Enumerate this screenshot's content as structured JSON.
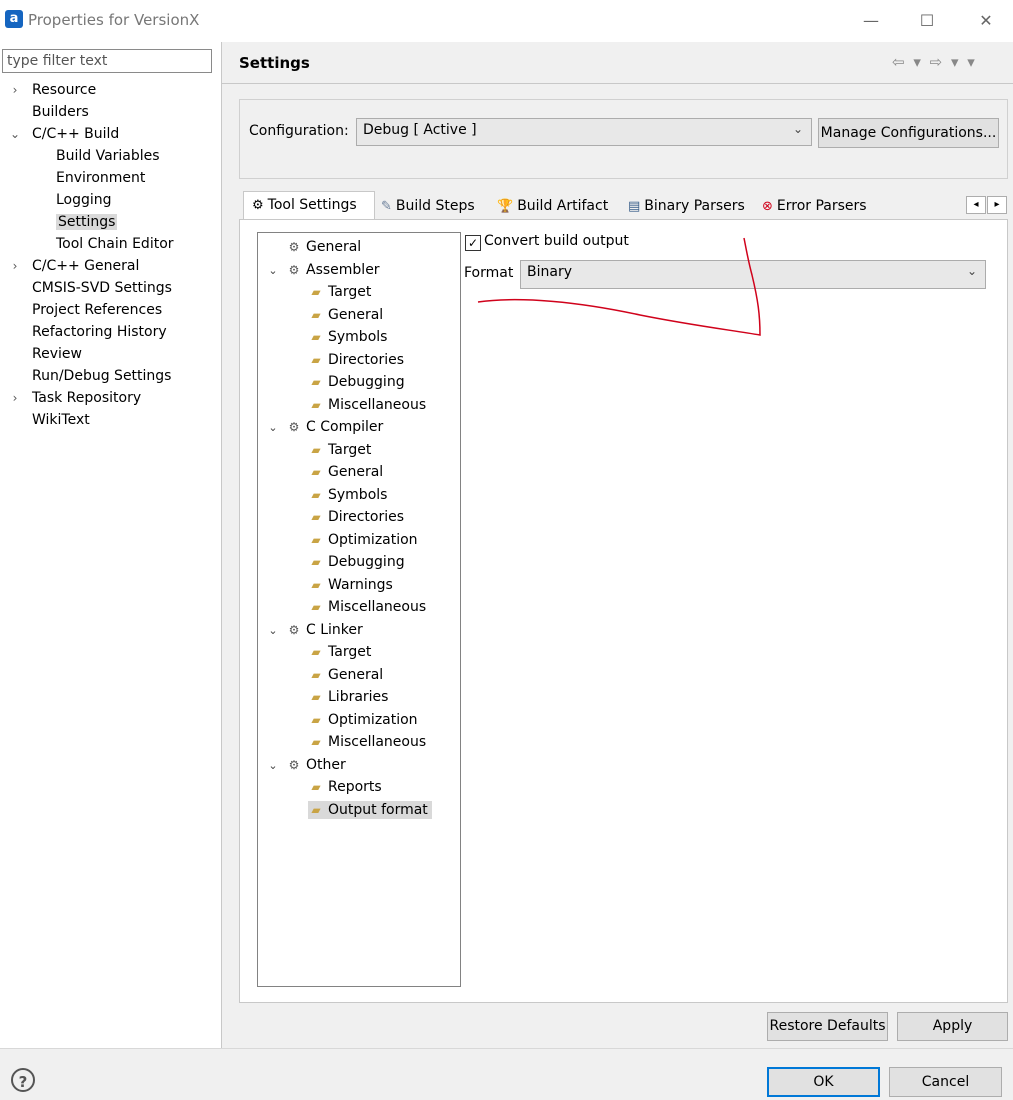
{
  "window": {
    "app_icon_label": "a",
    "title": "Properties for VersionX",
    "minimize": "—",
    "maximize": "☐",
    "close": "✕"
  },
  "left": {
    "filter_placeholder": "type filter text",
    "tree": [
      {
        "label": "Resource",
        "toggle": "›",
        "level": 0
      },
      {
        "label": "Builders",
        "toggle": "",
        "level": 0
      },
      {
        "label": "C/C++ Build",
        "toggle": "⌄",
        "level": 0
      },
      {
        "label": "Build Variables",
        "toggle": "",
        "level": 1
      },
      {
        "label": "Environment",
        "toggle": "",
        "level": 1
      },
      {
        "label": "Logging",
        "toggle": "",
        "level": 1
      },
      {
        "label": "Settings",
        "toggle": "",
        "level": 1,
        "selected": true
      },
      {
        "label": "Tool Chain Editor",
        "toggle": "",
        "level": 1
      },
      {
        "label": "C/C++ General",
        "toggle": "›",
        "level": 0
      },
      {
        "label": "CMSIS-SVD Settings",
        "toggle": "",
        "level": 0
      },
      {
        "label": "Project References",
        "toggle": "",
        "level": 0
      },
      {
        "label": "Refactoring History",
        "toggle": "",
        "level": 0
      },
      {
        "label": "Review",
        "toggle": "",
        "level": 0
      },
      {
        "label": "Run/Debug Settings",
        "toggle": "",
        "level": 0
      },
      {
        "label": "Task Repository",
        "toggle": "›",
        "level": 0
      },
      {
        "label": "WikiText",
        "toggle": "",
        "level": 0
      }
    ]
  },
  "right": {
    "title": "Settings",
    "nav_arrows": "⇦ ▾ ⇨ ▾ ▾",
    "configuration_label": "Configuration:",
    "configuration_value": "Debug  [ Active ]",
    "manage_button": "Manage Configurations...",
    "tabs": [
      {
        "label": "Tool Settings",
        "icon": "⚙",
        "active": true
      },
      {
        "label": "Build Steps",
        "icon": "✎"
      },
      {
        "label": "Build Artifact",
        "icon": "🏆"
      },
      {
        "label": "Binary Parsers",
        "icon": "▤"
      },
      {
        "label": "Error Parsers",
        "icon": "⊗"
      }
    ],
    "tab_scroll_left": "◂",
    "tab_scroll_right": "▸",
    "tool_tree": [
      {
        "label": "General",
        "level": 0,
        "toggle": ""
      },
      {
        "label": "Assembler",
        "level": 0,
        "toggle": "⌄"
      },
      {
        "label": "Target",
        "level": 1
      },
      {
        "label": "General",
        "level": 1
      },
      {
        "label": "Symbols",
        "level": 1
      },
      {
        "label": "Directories",
        "level": 1
      },
      {
        "label": "Debugging",
        "level": 1
      },
      {
        "label": "Miscellaneous",
        "level": 1
      },
      {
        "label": "C Compiler",
        "level": 0,
        "toggle": "⌄"
      },
      {
        "label": "Target",
        "level": 1
      },
      {
        "label": "General",
        "level": 1
      },
      {
        "label": "Symbols",
        "level": 1
      },
      {
        "label": "Directories",
        "level": 1
      },
      {
        "label": "Optimization",
        "level": 1
      },
      {
        "label": "Debugging",
        "level": 1
      },
      {
        "label": "Warnings",
        "level": 1
      },
      {
        "label": "Miscellaneous",
        "level": 1
      },
      {
        "label": "C Linker",
        "level": 0,
        "toggle": "⌄"
      },
      {
        "label": "Target",
        "level": 1
      },
      {
        "label": "General",
        "level": 1
      },
      {
        "label": "Libraries",
        "level": 1
      },
      {
        "label": "Optimization",
        "level": 1
      },
      {
        "label": "Miscellaneous",
        "level": 1
      },
      {
        "label": "Other",
        "level": 0,
        "toggle": "⌄"
      },
      {
        "label": "Reports",
        "level": 1
      },
      {
        "label": "Output format",
        "level": 1,
        "selected": true
      }
    ],
    "convert_label": "Convert build output",
    "convert_checked": "✓",
    "format_label": "Format",
    "format_value": "Binary",
    "combo_arrow": "⌄",
    "restore_defaults": "Restore Defaults",
    "apply": "Apply"
  },
  "footer": {
    "help": "?",
    "ok": "OK",
    "cancel": "Cancel"
  },
  "annotation_color": "#d0021b"
}
